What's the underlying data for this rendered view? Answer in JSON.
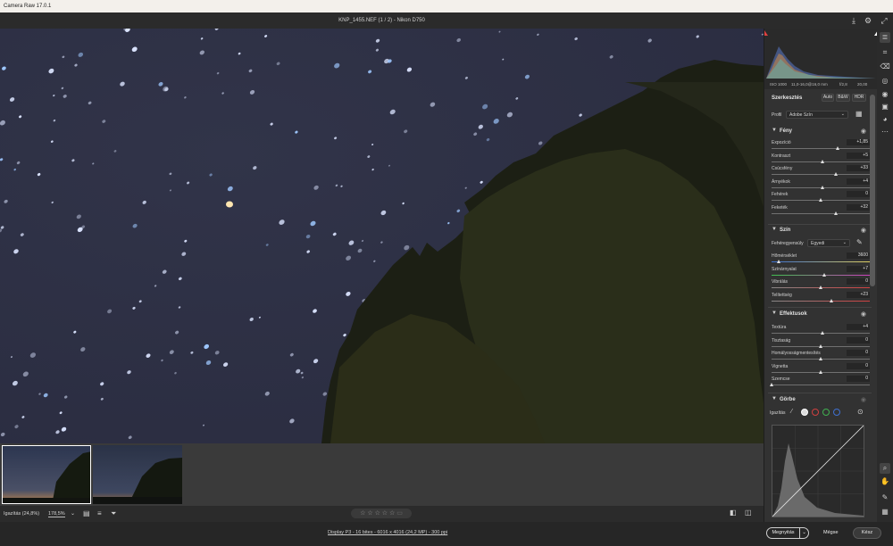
{
  "app": {
    "title": "Camera Raw 17.0.1"
  },
  "header": {
    "filename": "KNP_1455.NEF (1 / 2)  -  Nikon D750"
  },
  "histogram_info": {
    "iso": "ISO 1000",
    "lens": "11,0-16,0@16,0 mm",
    "aperture": "f/2,8",
    "shutter": "20,00"
  },
  "editor": {
    "title": "Szerkesztés",
    "buttons": {
      "auto": "Auto",
      "bw": "B&W",
      "hdr": "HDR"
    },
    "profile_label": "Profil",
    "profile_value": "Adobe Szín"
  },
  "sections": {
    "light": {
      "title": "Fény",
      "sliders": [
        {
          "label": "Expozíció",
          "value": "+1,85",
          "pos": 0.68
        },
        {
          "label": "Kontraszt",
          "value": "+5",
          "pos": 0.52
        },
        {
          "label": "Csúcsfény",
          "value": "+33",
          "pos": 0.66
        },
        {
          "label": "Árnyékok",
          "value": "+4",
          "pos": 0.52
        },
        {
          "label": "Fehérek",
          "value": "0",
          "pos": 0.5
        },
        {
          "label": "Feketék",
          "value": "+32",
          "pos": 0.66
        }
      ]
    },
    "color": {
      "title": "Szín",
      "wb_label": "Fehéregyensúly",
      "wb_value": "Egyedi",
      "sliders": [
        {
          "label": "Hőmérséklet",
          "value": "3600",
          "pos": 0.08
        },
        {
          "label": "Színárnyalat",
          "value": "+7",
          "pos": 0.54
        },
        {
          "label": "Vibrálás",
          "value": "0",
          "pos": 0.5
        },
        {
          "label": "Telítettség",
          "value": "+23",
          "pos": 0.61
        }
      ]
    },
    "effects": {
      "title": "Effektusok",
      "sliders": [
        {
          "label": "Textúra",
          "value": "+4",
          "pos": 0.52
        },
        {
          "label": "Tisztaság",
          "value": "0",
          "pos": 0.5
        },
        {
          "label": "Homályosságmentesítés",
          "value": "0",
          "pos": 0.5
        },
        {
          "label": "Vignetta",
          "value": "0",
          "pos": 0.5
        },
        {
          "label": "Szemcse",
          "value": "0",
          "pos": 0.0
        }
      ]
    },
    "curve": {
      "title": "Görbe",
      "adjust_label": "Igazítás"
    }
  },
  "bottombar": {
    "zoom_label": "Igazítás (24,8%)",
    "zoom_value": "178,5%"
  },
  "statusbar": {
    "info": "Display P3 - 16 bites - 6016 x 4016 (24,2 MP) - 300 ppi",
    "open_button": "Megnyitás",
    "cancel_button": "Mégse",
    "done_button": "Kész"
  }
}
